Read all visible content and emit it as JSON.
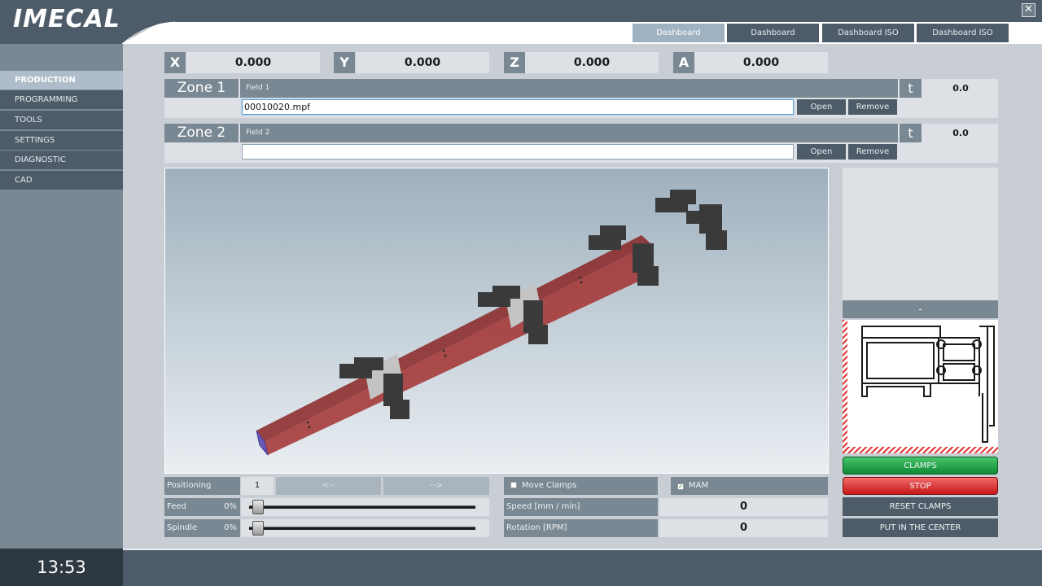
{
  "app": {
    "logo": "IMECAL"
  },
  "header": {
    "tabs": [
      {
        "label": "Dashboard",
        "active": true
      },
      {
        "label": "Dashboard",
        "active": false
      },
      {
        "label": "Dashboard ISO",
        "active": false
      },
      {
        "label": "Dashboard ISO",
        "active": false
      }
    ],
    "close_glyph": "✕"
  },
  "sidebar": {
    "items": [
      {
        "label": "PRODUCTION",
        "active": true
      },
      {
        "label": "PROGRAMMING",
        "active": false
      },
      {
        "label": "TOOLS",
        "active": false
      },
      {
        "label": "SETTINGS",
        "active": false
      },
      {
        "label": "DIAGNOSTIC",
        "active": false
      },
      {
        "label": "CAD",
        "active": false
      }
    ]
  },
  "axes": [
    {
      "label": "X",
      "value": "0.000"
    },
    {
      "label": "Y",
      "value": "0.000"
    },
    {
      "label": "Z",
      "value": "0.000"
    },
    {
      "label": "A",
      "value": "0.000"
    }
  ],
  "zones": [
    {
      "title": "Zone 1",
      "field": "Field 1",
      "t_label": "t",
      "t_value": "0.0",
      "file": "00010020.mpf",
      "open": "Open",
      "remove": "Remove"
    },
    {
      "title": "Zone 2",
      "field": "Field 2",
      "t_label": "t",
      "t_value": "0.0",
      "file": "",
      "open": "Open",
      "remove": "Remove"
    }
  ],
  "controls": {
    "positioning_label": "Positioning",
    "positioning_value": "1",
    "prev_label": "<--",
    "next_label": "-->",
    "feed_label": "Feed",
    "feed_pct": "0%",
    "feed_level": 0,
    "spindle_label": "Spindle",
    "spindle_pct": "0%",
    "spindle_level": 0,
    "move_clamps_label": "Move Clamps",
    "move_clamps_checked": false,
    "mam_label": "MAM",
    "mam_checked": true,
    "speed_label": "Speed [mm / min]",
    "speed_value": "0",
    "rotation_label": "Rotation [RPM]",
    "rotation_value": "0"
  },
  "right_panel": {
    "profile_caption": "-",
    "clamps_label": "CLAMPS",
    "stop_label": "STOP",
    "reset_clamps_label": "RESET CLAMPS",
    "center_label": "PUT IN THE CENTER"
  },
  "status": {
    "clock": "13:53"
  },
  "colors": {
    "dark_slate": "#4d5c68",
    "mid_slate": "#7a8893",
    "active_tab": "#9eb2c2",
    "panel_light": "#dde1e5",
    "clamps_green": "#0e8a34",
    "stop_red": "#c81818",
    "bar_red": "#a02828"
  }
}
